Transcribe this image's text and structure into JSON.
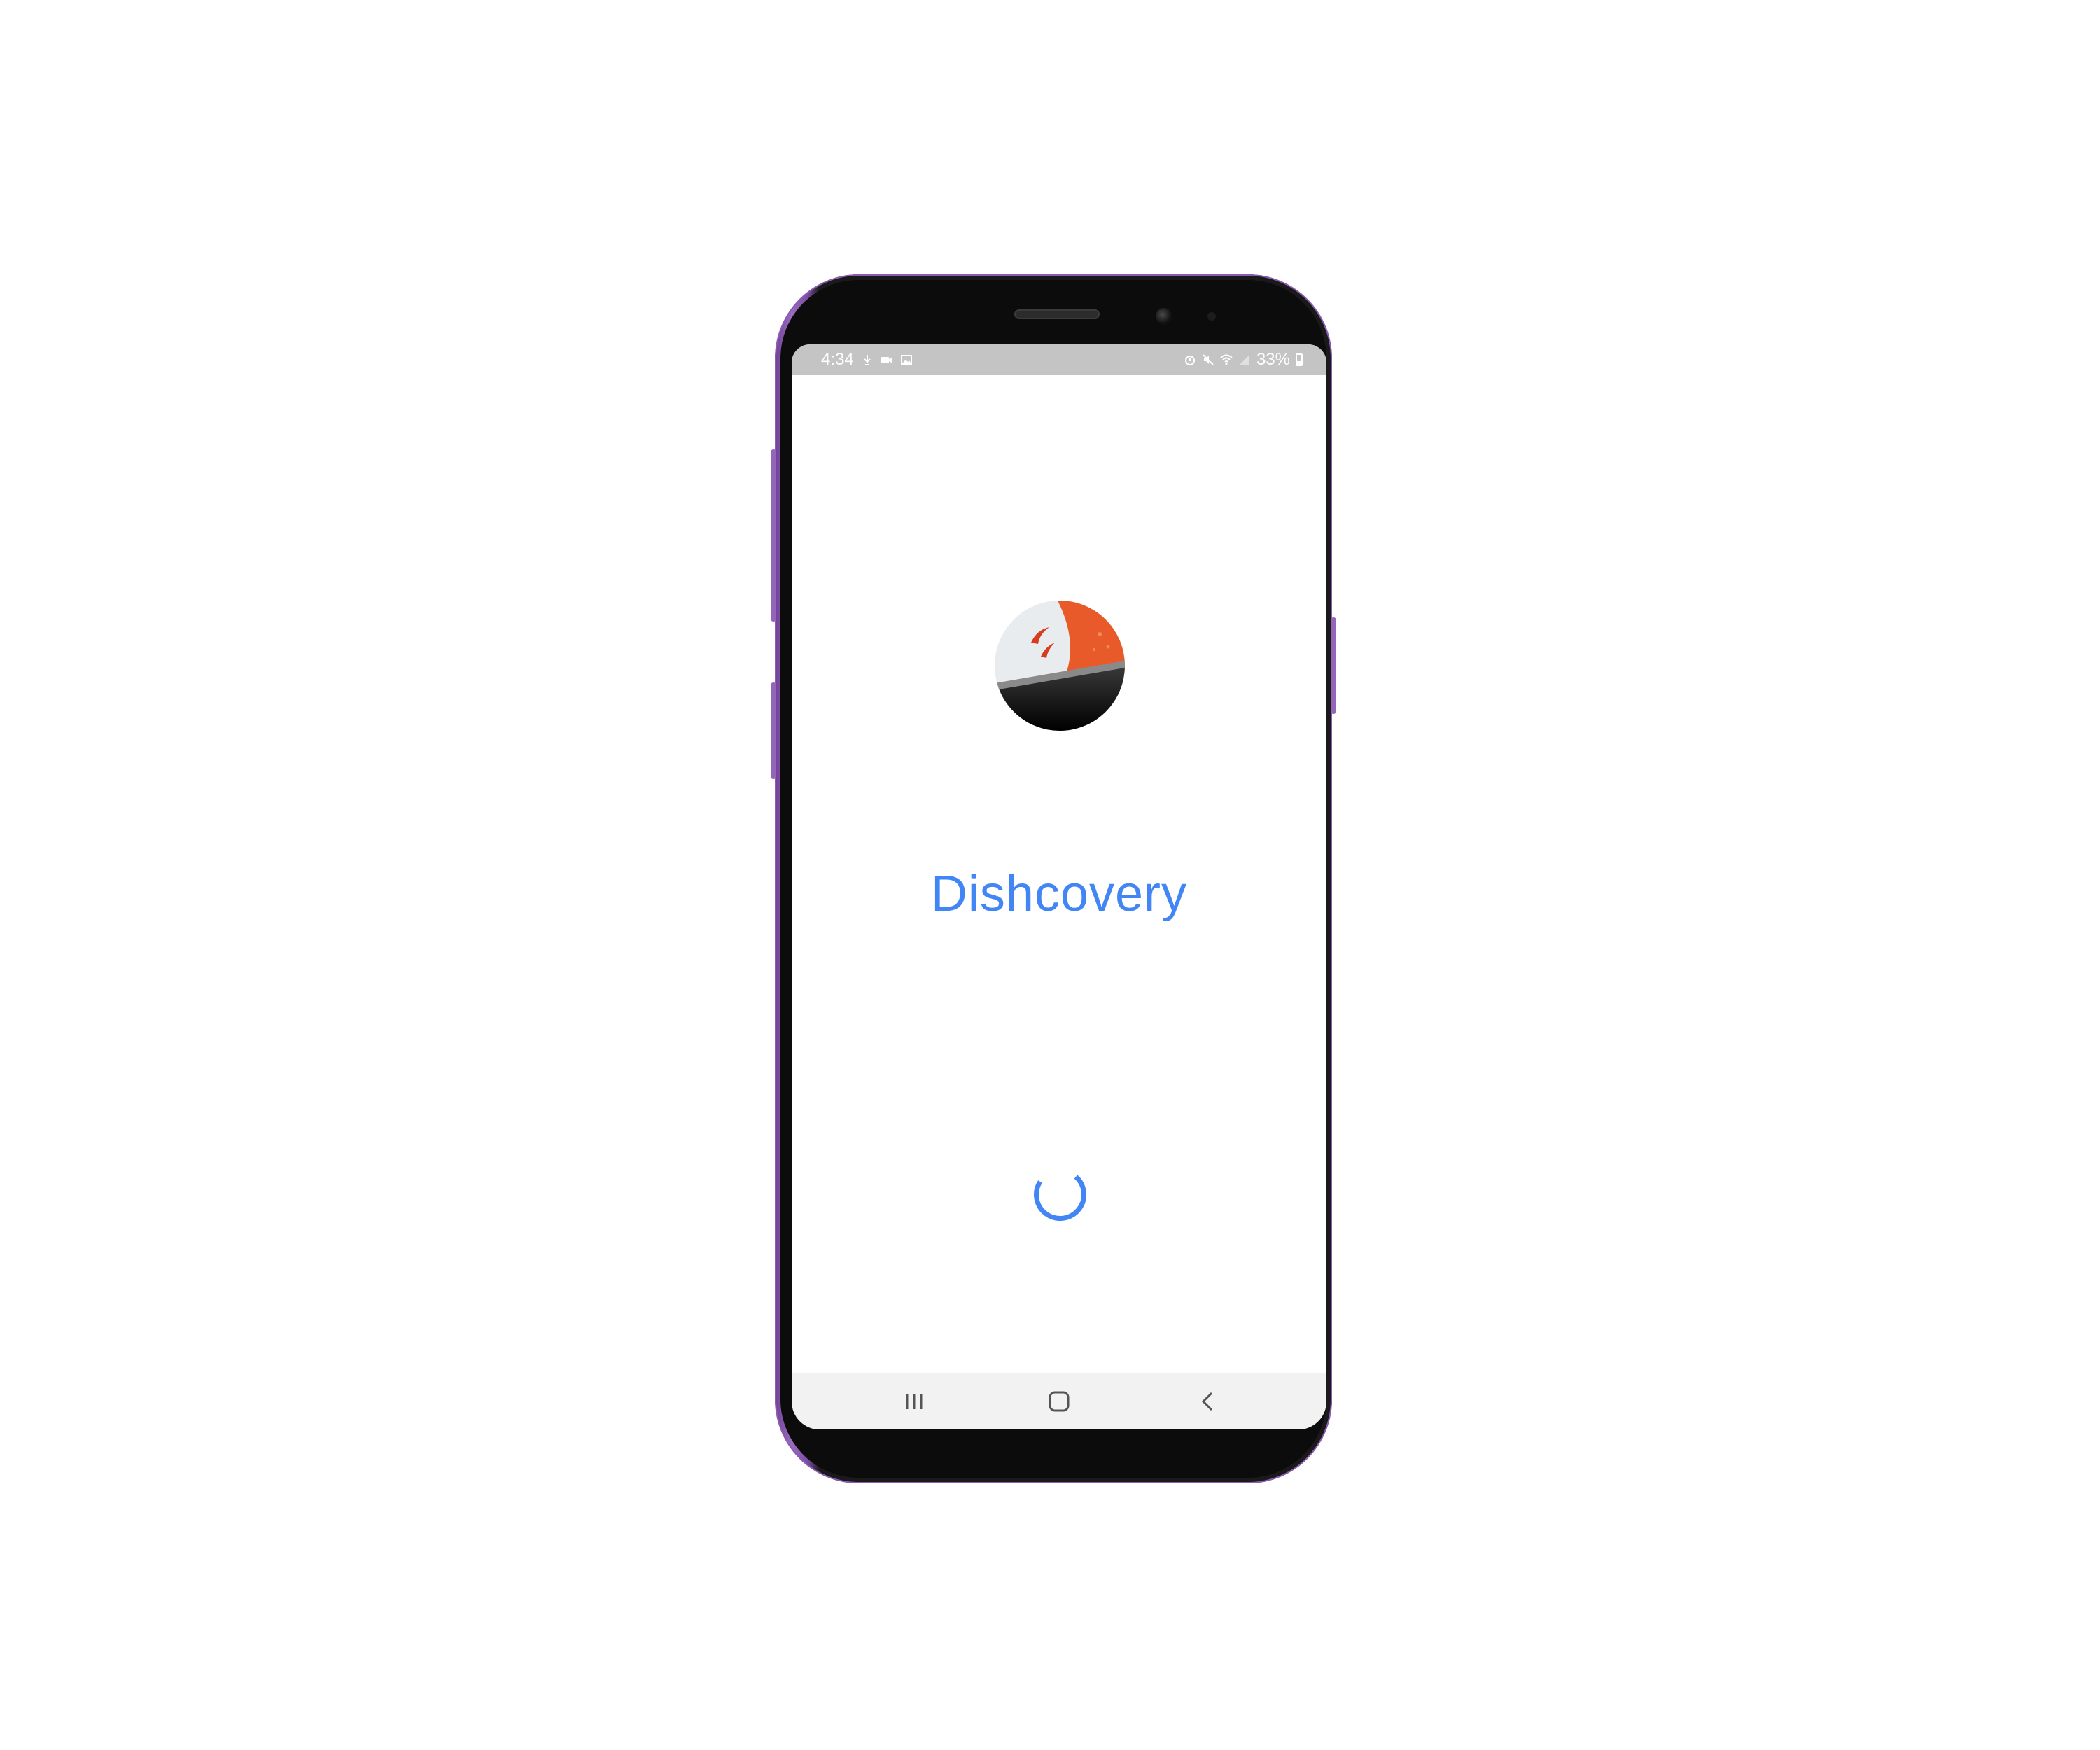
{
  "status_bar": {
    "time": "4:34",
    "battery": "33%",
    "left_icons": [
      "usb-debug-icon",
      "video-icon",
      "image-icon"
    ],
    "right_icons": [
      "alarm-icon",
      "mute-icon",
      "wifi-icon",
      "signal-icon",
      "battery-icon"
    ]
  },
  "app": {
    "title": "Dishcovery",
    "title_color": "#4285f4"
  },
  "loading": {
    "indicator": "spinner-icon",
    "color": "#4285f4"
  },
  "nav_bar": {
    "buttons": [
      "recent-apps-icon",
      "home-icon",
      "back-icon"
    ]
  },
  "device": {
    "frame_color": "#8c5bb3"
  }
}
